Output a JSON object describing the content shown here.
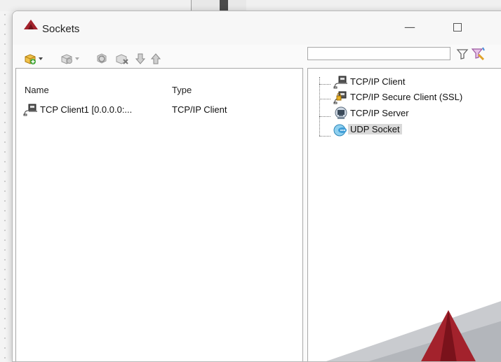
{
  "window": {
    "title": "Sockets"
  },
  "window_controls": {
    "minimize": "—"
  },
  "toolbar": {
    "icons": [
      "add-socket-icon",
      "socket-options-icon",
      "refresh-icon",
      "delete-icon",
      "move-down-icon",
      "move-up-icon"
    ]
  },
  "filter": {
    "value": "",
    "placeholder": ""
  },
  "list": {
    "columns": [
      "Name",
      "Type"
    ],
    "rows": [
      {
        "name": "TCP Client1 [0.0.0.0:...",
        "type": "TCP/IP Client"
      }
    ]
  },
  "tree": {
    "items": [
      {
        "label": "TCP/IP Client",
        "icon": "tcp-client-icon"
      },
      {
        "label": "TCP/IP Secure Client (SSL)",
        "icon": "ssl-client-icon"
      },
      {
        "label": "TCP/IP Server",
        "icon": "server-icon"
      },
      {
        "label": "UDP Socket",
        "icon": "udp-icon",
        "selected": true
      }
    ]
  },
  "colors": {
    "brand": "#a3222c",
    "selection": "#d9d9d9"
  }
}
